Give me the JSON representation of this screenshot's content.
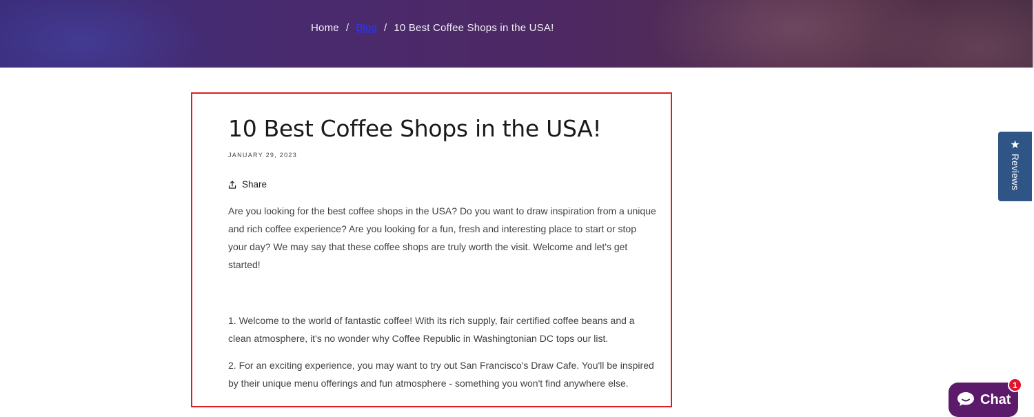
{
  "breadcrumb": {
    "home": "Home",
    "separator": "/",
    "blog": "Blog",
    "current": "10 Best Coffee Shops in the USA!"
  },
  "article": {
    "title": "10 Best Coffee Shops in the USA!",
    "date": "JANUARY 29, 2023",
    "share_label": "Share",
    "paragraphs": [
      "Are you looking for the best coffee shops in the USA? Do you want to draw inspiration from a unique and rich coffee experience? Are you looking for a fun, fresh and interesting place to start or stop your day? We may say that these coffee shops are truly worth the visit. Welcome and let's get started!",
      "1. Welcome to the world of fantastic coffee! With its rich supply, fair certified coffee beans and a clean atmosphere, it's no wonder why Coffee Republic in Washingtonian DC tops our list.",
      "2. For an exciting experience, you may want to try out San Francisco's Draw Cafe. You'll be inspired by their unique menu offerings and fun atmosphere - something you won't find anywhere else."
    ]
  },
  "reviews_tab": {
    "label": "Reviews",
    "icon": "star-icon",
    "color": "#2f5486"
  },
  "chat_widget": {
    "label": "Chat",
    "badge_count": "1",
    "icon": "chat-bubble-icon",
    "color": "#5c1a6a",
    "badge_color": "#e0142a"
  },
  "colors": {
    "highlight_border": "#e01b24",
    "link": "#2b36ff"
  }
}
